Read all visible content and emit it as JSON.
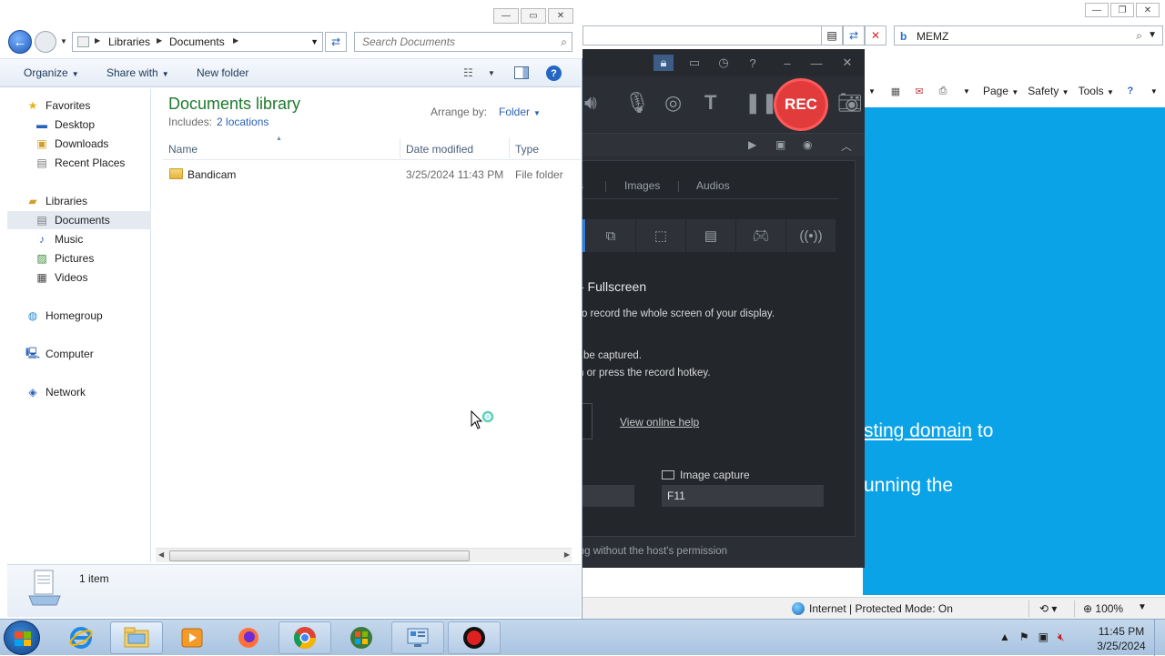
{
  "explorer": {
    "breadcrumb": [
      "Libraries",
      "Documents"
    ],
    "search_placeholder": "Search Documents",
    "toolbar": {
      "organize": "Organize",
      "share_with": "Share with",
      "new_folder": "New folder"
    },
    "nav": {
      "favorites": "Favorites",
      "desktop": "Desktop",
      "downloads": "Downloads",
      "recent_places": "Recent Places",
      "libraries": "Libraries",
      "documents": "Documents",
      "music": "Music",
      "pictures": "Pictures",
      "videos": "Videos",
      "homegroup": "Homegroup",
      "computer": "Computer",
      "network": "Network"
    },
    "library_title": "Documents library",
    "includes_label": "Includes:",
    "includes_link": "2 locations",
    "arrange_by_label": "Arrange by:",
    "arrange_by_value": "Folder",
    "columns": {
      "name": "Name",
      "date_modified": "Date modified",
      "type": "Type"
    },
    "files": [
      {
        "name": "Bandicam",
        "date_modified": "3/25/2024 11:43 PM",
        "type": "File folder"
      }
    ],
    "status_count": "1 item"
  },
  "bandicam": {
    "rec_label": "REC",
    "tabs": {
      "partial": "s",
      "images": "Images",
      "audios": "Audios"
    },
    "mode_heading": "- Fullscreen",
    "desc_line1": "o record the whole screen of your display.",
    "desc_line2": "be captured.",
    "desc_line3": "n or press the record hotkey.",
    "help_link": "View online help",
    "image_capture_label": "Image capture",
    "image_capture_hotkey": "F11",
    "footer_text": "ting without the host's permission"
  },
  "ie": {
    "search_value": "MEMZ",
    "commands": {
      "page": "Page",
      "safety": "Safety",
      "tools": "Tools"
    },
    "content_line1_link": "sting domain",
    "content_line1_rest": " to",
    "content_line2": "unning the",
    "status_zone": "Internet | Protected Mode: On",
    "zoom": "100%"
  },
  "taskbar": {
    "time": "11:45 PM",
    "date": "3/25/2024"
  },
  "colors": {
    "ie_content_bg": "#0aa3e8",
    "library_title": "#1e7a2e",
    "link_blue": "#2a62b8",
    "rec_red": "#e23b3b",
    "bandicam_bg": "#2b2e34"
  }
}
